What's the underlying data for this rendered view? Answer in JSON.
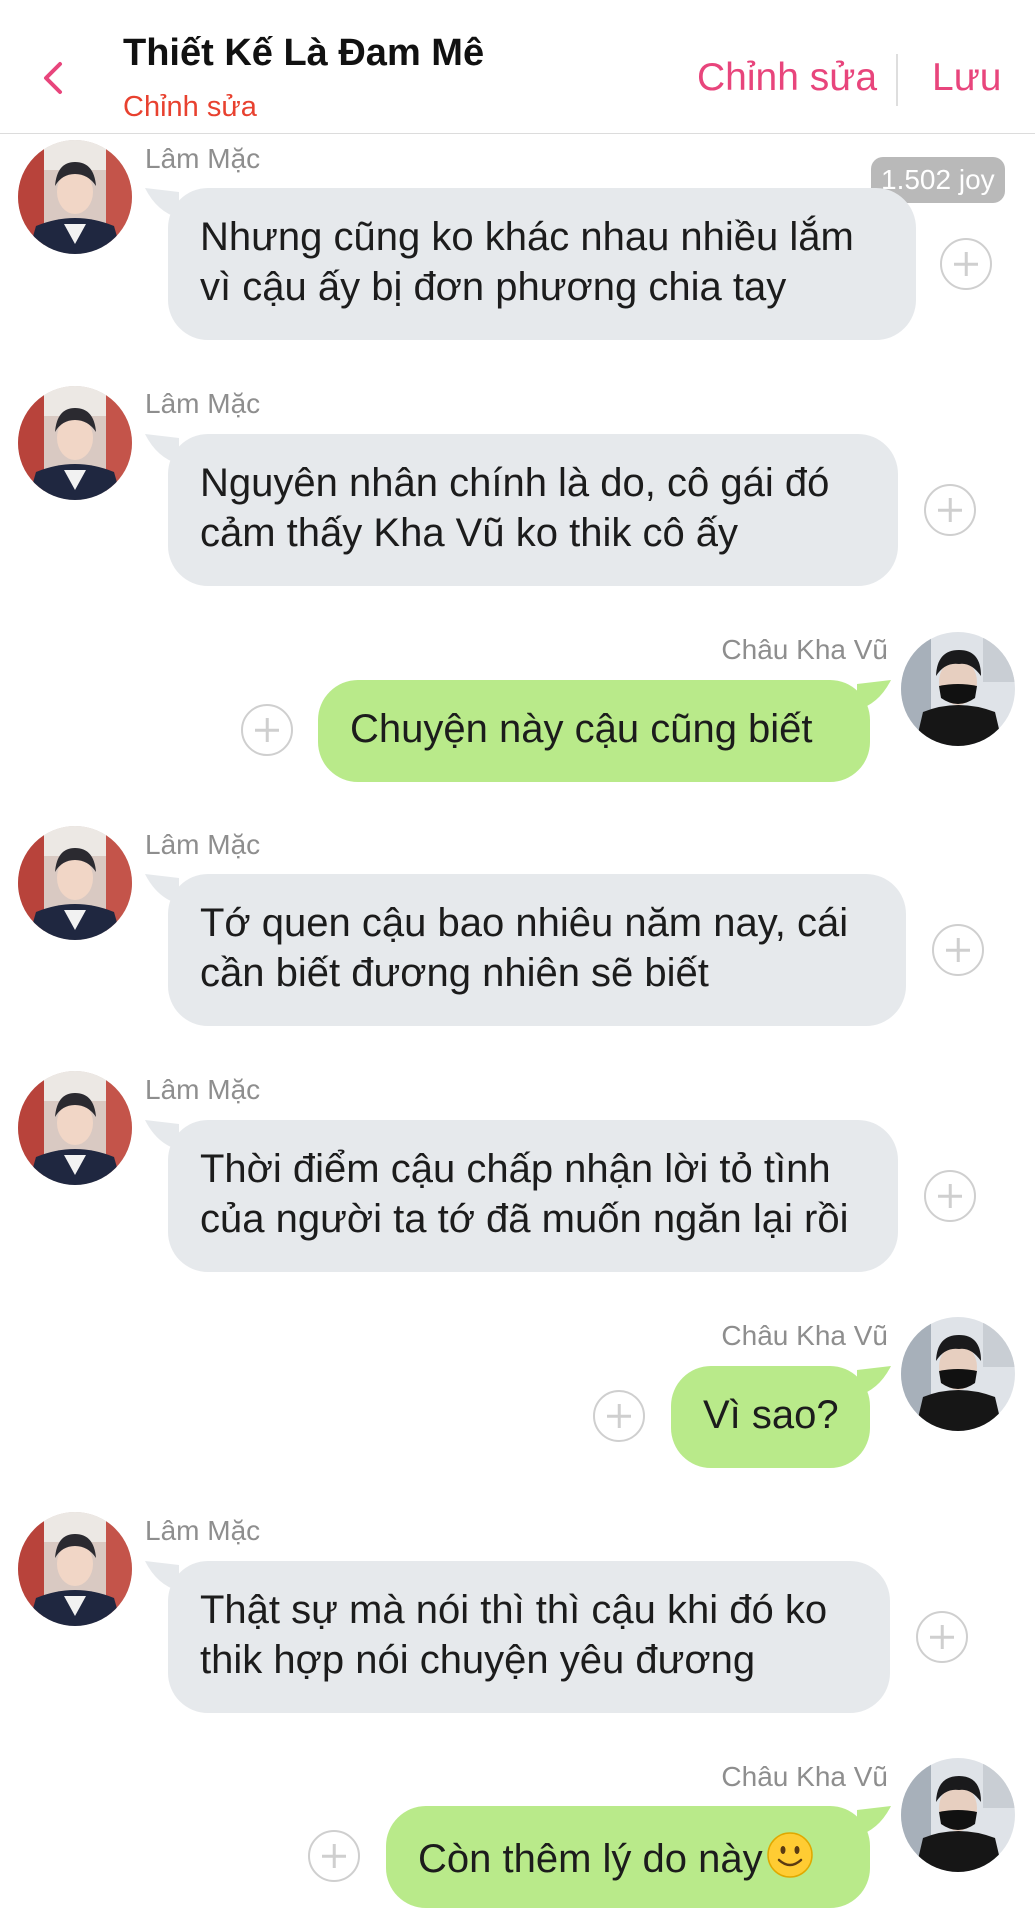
{
  "header": {
    "title": "Thiết Kế Là Đam Mê",
    "subtitle": "Chỉnh sửa",
    "edit_label": "Chỉnh sửa",
    "save_label": "Lưu"
  },
  "joy_badge": "1.502 joy",
  "colors": {
    "accent": "#e8457c",
    "subtitle": "#e8412f",
    "bubble_left": "#e6e9ec",
    "bubble_right": "#b9ea8a"
  },
  "messages": [
    {
      "sender": "Lâm Mặc",
      "side": "left",
      "lines": [
        "Nhưng cũng ko khác nhau nhiều lắm",
        "vì cậu ấy bị đơn phương chia tay"
      ]
    },
    {
      "sender": "Lâm Mặc",
      "side": "left",
      "lines": [
        "Nguyên nhân chính là do, cô gái đó",
        "cảm thấy Kha Vũ ko thik cô ấy"
      ]
    },
    {
      "sender": "Châu Kha Vũ",
      "side": "right",
      "lines": [
        "Chuyện này cậu cũng biết"
      ]
    },
    {
      "sender": "Lâm Mặc",
      "side": "left",
      "lines": [
        "Tớ quen cậu bao nhiêu năm nay, cái",
        "cần biết đương nhiên sẽ biết"
      ]
    },
    {
      "sender": "Lâm Mặc",
      "side": "left",
      "lines": [
        "Thời điểm cậu chấp nhận lời tỏ tình",
        "của người ta tớ đã muốn ngăn lại rồi"
      ]
    },
    {
      "sender": "Châu Kha Vũ",
      "side": "right",
      "lines": [
        "Vì sao?"
      ]
    },
    {
      "sender": "Lâm Mặc",
      "side": "left",
      "lines": [
        "Thật sự mà nói thì thì cậu khi đó ko",
        "thik hợp nói chuyện yêu đương"
      ]
    },
    {
      "sender": "Châu Kha Vũ",
      "side": "right",
      "lines": [
        "Còn thêm lý do này"
      ],
      "emoji": "smiling-face-emoji"
    }
  ]
}
